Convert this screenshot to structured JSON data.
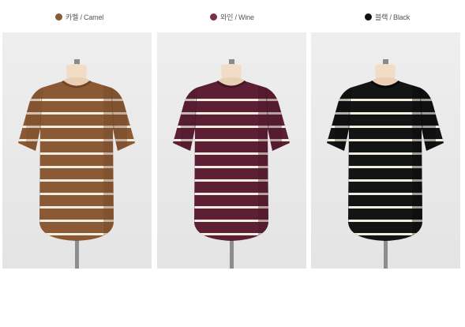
{
  "variants": [
    {
      "label": "카멜 / Camel",
      "swatch_color": "#8a5a35",
      "shirt_color": "#8b5a35",
      "shirt_shade": "#6f4526",
      "stripe_color": "#f3ece0",
      "icon": "striped-tshirt-icon"
    },
    {
      "label": "와인 / Wine",
      "swatch_color": "#7a2e4d",
      "shirt_color": "#5c1f33",
      "shirt_shade": "#451626",
      "stripe_color": "#f3ece0",
      "icon": "striped-tshirt-icon"
    },
    {
      "label": "블랙 / Black",
      "swatch_color": "#111111",
      "shirt_color": "#141414",
      "shirt_shade": "#050505",
      "stripe_color": "#f3ece0",
      "icon": "striped-tshirt-icon"
    }
  ]
}
